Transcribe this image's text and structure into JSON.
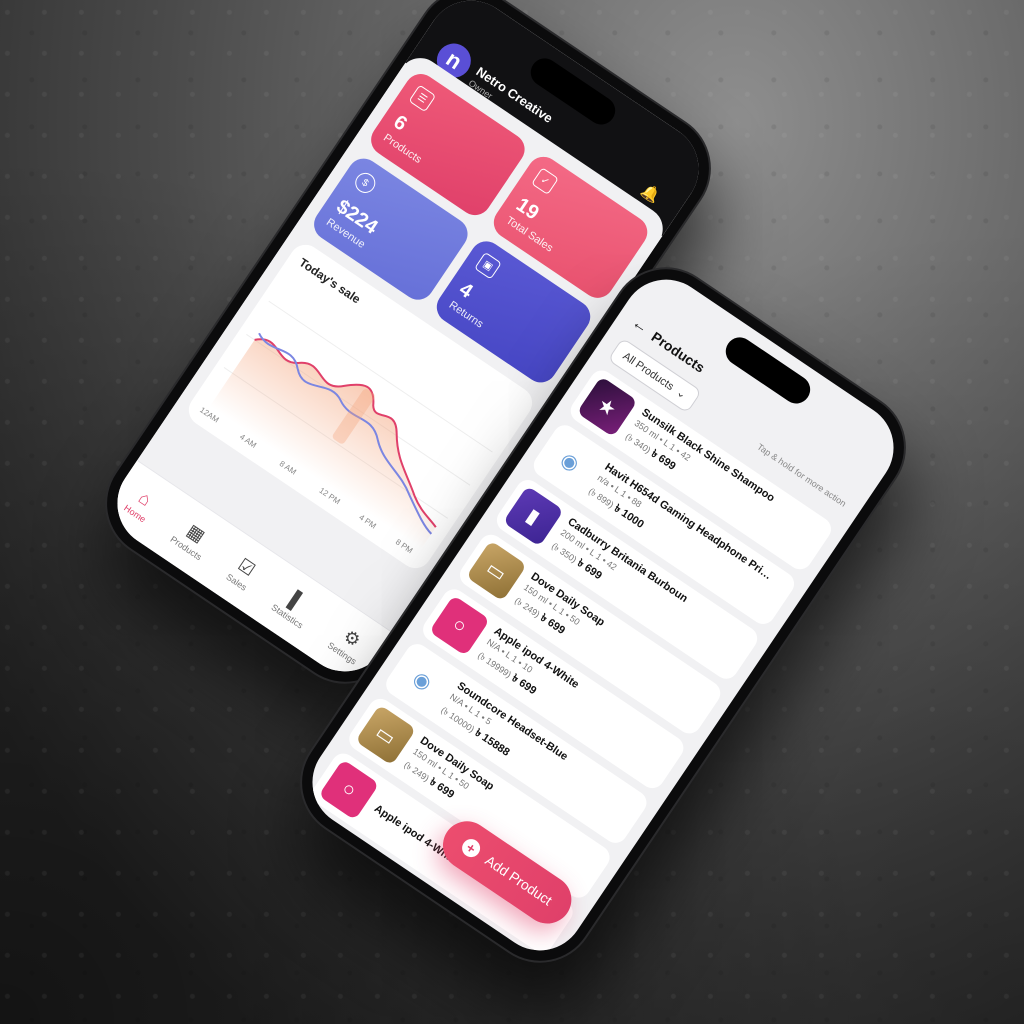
{
  "dashboard": {
    "brand_name": "Netro Creative",
    "brand_role": "Owner",
    "avatar_letter": "n",
    "cards": [
      {
        "value": "6",
        "label": "Products",
        "icon": "list-icon"
      },
      {
        "value": "19",
        "label": "Total Sales",
        "icon": "clipboard-icon"
      },
      {
        "value": "$224",
        "label": "Revenue",
        "icon": "dollar-icon"
      },
      {
        "value": "4",
        "label": "Returns",
        "icon": "box-icon"
      }
    ],
    "sale_title": "Today's sale",
    "chart_ticks": [
      "12AM",
      "4 AM",
      "8 AM",
      "12 PM",
      "4 PM",
      "8 PM"
    ],
    "tabs": [
      {
        "label": "Home",
        "icon": "home-icon"
      },
      {
        "label": "Products",
        "icon": "products-icon"
      },
      {
        "label": "Sales",
        "icon": "sales-icon"
      },
      {
        "label": "Statistics",
        "icon": "statistics-icon"
      },
      {
        "label": "Settings",
        "icon": "settings-icon"
      }
    ],
    "colors": {
      "accent": "#e0406a",
      "indigo": "#4646c4",
      "periwinkle": "#6670d8"
    }
  },
  "products_screen": {
    "title": "Products",
    "filter_label": "All Products",
    "hint": "Tap & hold for more action",
    "items": [
      {
        "name": "Sunsilk Black Shine Shampoo",
        "meta": "350 ml • L 1 • 42",
        "old_price": "(৳ 340)",
        "price": "৳ 699"
      },
      {
        "name": "Havit H654d Gaming Headphone Pric...",
        "meta": "n/a • L 1 • 88",
        "old_price": "(৳ 899)",
        "price": "৳ 1000"
      },
      {
        "name": "Cadburry Britania Burboun",
        "meta": "200 ml • L 1 • 42",
        "old_price": "(৳ 350)",
        "price": "৳ 699"
      },
      {
        "name": "Dove Daily Soap",
        "meta": "150 ml • L 1 • 50",
        "old_price": "(৳ 249)",
        "price": "৳ 699"
      },
      {
        "name": "Apple ipod 4-White",
        "meta": "N/A • L 1 • 10",
        "old_price": "(৳ 19999)",
        "price": "৳ 699"
      },
      {
        "name": "Soundcore Headset-Blue",
        "meta": "N/A • L 1 • 5",
        "old_price": "(৳ 10000)",
        "price": "৳ 15888"
      },
      {
        "name": "Dove Daily Soap",
        "meta": "150 ml • L 1 • 50",
        "old_price": "(৳ 249)",
        "price": "৳ 699"
      },
      {
        "name": "Apple ipod 4-White",
        "meta": "",
        "old_price": "",
        "price": ""
      }
    ],
    "fab_label": "Add Product"
  }
}
